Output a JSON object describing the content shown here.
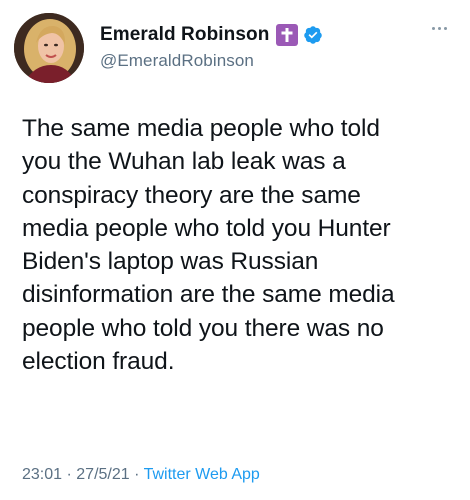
{
  "tweet": {
    "author": {
      "display_name": "Emerald Robinson",
      "handle": "@EmeraldRobinson",
      "badge_icon": "cross-icon",
      "badge_color": "#9b59b6",
      "verified_icon": "verified-check-icon",
      "verified_color": "#1d9bf0"
    },
    "more_icon": "more-dots-icon",
    "text": "The same media people who told\nyou the Wuhan lab leak was a\nconspiracy theory are the same\nmedia people who told you Hunter\nBiden's laptop was Russian\ndisinformation are the same media\npeople who told you there was no\nelection fraud.",
    "meta": {
      "time": "23:01",
      "separator": "·",
      "date": "27/5/21",
      "source": "Twitter Web App"
    }
  },
  "colors": {
    "text": "#0f1419",
    "secondary_text": "#5b7083",
    "link": "#1d9bf0"
  }
}
